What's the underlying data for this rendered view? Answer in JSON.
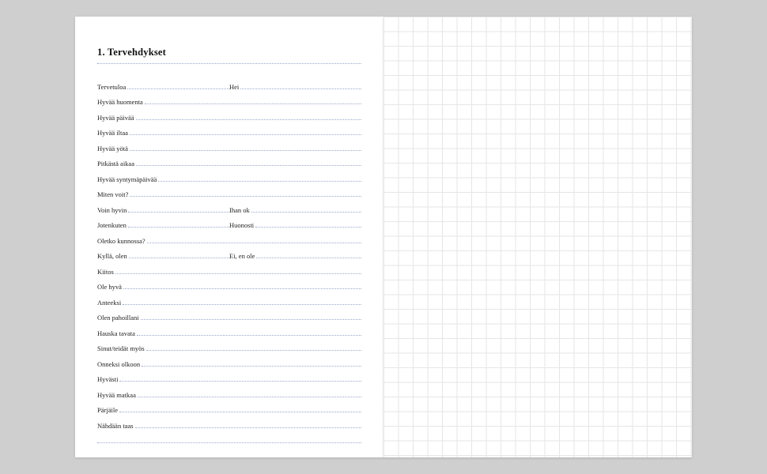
{
  "title": "1. Tervehdykset",
  "rows": [
    {
      "cells": [
        "Tervetuloa",
        "Hei"
      ]
    },
    {
      "cells": [
        "Hyvää huomenta"
      ]
    },
    {
      "cells": [
        "Hyvää päivää"
      ]
    },
    {
      "cells": [
        "Hyvää iltaa"
      ]
    },
    {
      "cells": [
        "Hyvää yötä"
      ]
    },
    {
      "cells": [
        "Pitkästä aikaa"
      ]
    },
    {
      "cells": [
        "Hyvää syntymäpäivää"
      ]
    },
    {
      "cells": [
        "Miten voit?"
      ]
    },
    {
      "cells": [
        "Voin hyvin",
        "Ihan ok"
      ]
    },
    {
      "cells": [
        "Jotenkuten",
        "Huonosti"
      ]
    },
    {
      "cells": [
        "Oletko kunnossa?"
      ]
    },
    {
      "cells": [
        "Kyllä, olen",
        "Ei, en ole"
      ]
    },
    {
      "cells": [
        "Kiitos"
      ]
    },
    {
      "cells": [
        "Ole hyvä"
      ]
    },
    {
      "cells": [
        "Anteeksi"
      ]
    },
    {
      "cells": [
        "Olen pahoillani"
      ]
    },
    {
      "cells": [
        "Hauska tavata"
      ]
    },
    {
      "cells": [
        "Sinut/teidät myös"
      ]
    },
    {
      "cells": [
        "Onneksi olkoon"
      ]
    },
    {
      "cells": [
        "Hyvästi"
      ]
    },
    {
      "cells": [
        "Hyvää matkaa"
      ]
    },
    {
      "cells": [
        "Pärjäile"
      ]
    },
    {
      "cells": [
        "Nähdään taas"
      ]
    },
    {
      "cells": [
        ""
      ]
    }
  ]
}
